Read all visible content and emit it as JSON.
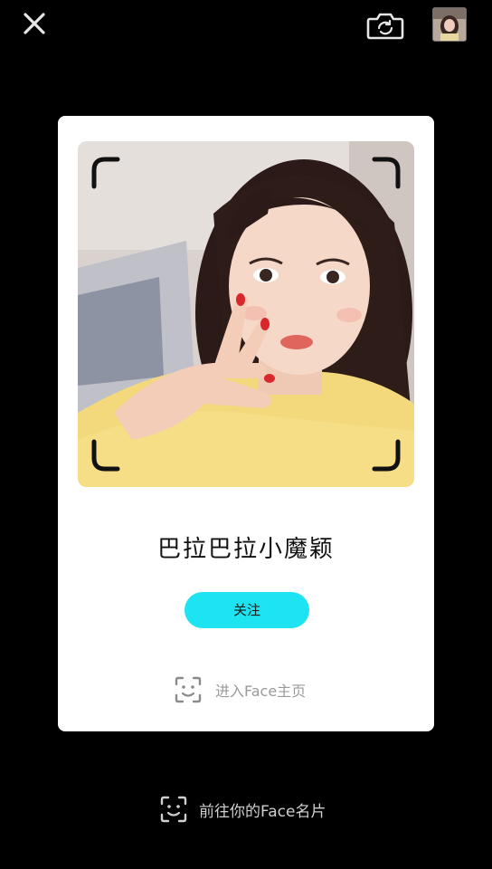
{
  "topbar": {
    "close_icon": "close-icon",
    "camera_icon": "camera-switch-icon"
  },
  "card": {
    "name": "巴拉巴拉小魔颖",
    "follow_label": "关注",
    "enter_face_label": "进入Face主页",
    "enter_face_icon": "face-scan-icon"
  },
  "bottom": {
    "label": "前往你的Face名片",
    "icon": "face-scan-icon"
  },
  "colors": {
    "background": "#000000",
    "card": "#ffffff",
    "accent": "#1ee3f0",
    "muted_text": "#9a9a9a"
  }
}
